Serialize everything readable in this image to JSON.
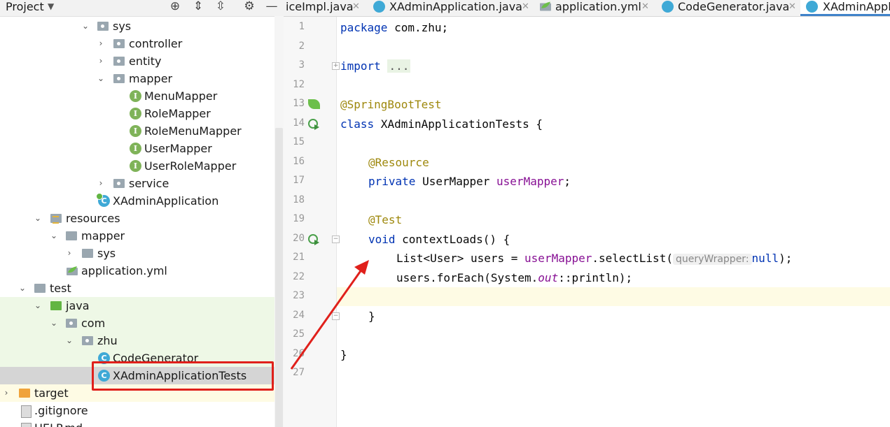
{
  "project_panel": {
    "title": "Project",
    "tree": [
      {
        "label": "sys",
        "type": "package",
        "arrow": "down"
      },
      {
        "label": "controller",
        "type": "package",
        "arrow": "right"
      },
      {
        "label": "entity",
        "type": "package",
        "arrow": "right"
      },
      {
        "label": "mapper",
        "type": "package",
        "arrow": "down"
      },
      {
        "label": "MenuMapper",
        "type": "interface"
      },
      {
        "label": "RoleMapper",
        "type": "interface"
      },
      {
        "label": "RoleMenuMapper",
        "type": "interface"
      },
      {
        "label": "UserMapper",
        "type": "interface"
      },
      {
        "label": "UserRoleMapper",
        "type": "interface"
      },
      {
        "label": "service",
        "type": "package",
        "arrow": "right"
      },
      {
        "label": "XAdminApplication",
        "type": "class"
      },
      {
        "label": "resources",
        "type": "resources-folder",
        "arrow": "down"
      },
      {
        "label": "mapper",
        "type": "folder",
        "arrow": "down"
      },
      {
        "label": "sys",
        "type": "folder",
        "arrow": "right"
      },
      {
        "label": "application.yml",
        "type": "yml"
      },
      {
        "label": "test",
        "type": "folder",
        "arrow": "down"
      },
      {
        "label": "java",
        "type": "test-folder",
        "arrow": "down"
      },
      {
        "label": "com",
        "type": "package",
        "arrow": "down"
      },
      {
        "label": "zhu",
        "type": "package",
        "arrow": "down"
      },
      {
        "label": "CodeGenerator",
        "type": "class"
      },
      {
        "label": "XAdminApplicationTests",
        "type": "class",
        "selected": true
      },
      {
        "label": "target",
        "type": "excluded-folder",
        "arrow": "right"
      },
      {
        "label": ".gitignore",
        "type": "file"
      },
      {
        "label": "HELP.md",
        "type": "file"
      }
    ]
  },
  "tabs": [
    {
      "label": "iceImpl.java",
      "icon": "none"
    },
    {
      "label": "XAdminApplication.java",
      "icon": "class-icon"
    },
    {
      "label": "application.yml",
      "icon": "spring-yml-icon"
    },
    {
      "label": "CodeGenerator.java",
      "icon": "class-icon"
    },
    {
      "label": "XAdminAppli",
      "icon": "class-icon",
      "active": true
    }
  ],
  "editor": {
    "line_numbers": [
      "1",
      "2",
      "3",
      "12",
      "13",
      "14",
      "15",
      "16",
      "17",
      "18",
      "19",
      "20",
      "21",
      "22",
      "23",
      "24",
      "25",
      "26",
      "27"
    ],
    "code": {
      "package_kw": "package",
      "package_name": " com.zhu;",
      "import_kw": "import",
      "import_ellipsis": "...",
      "annotation_springboot": "@SpringBootTest",
      "class_kw": "class",
      "class_name": " XAdminApplicationTests {",
      "annotation_resource": "@Resource",
      "private_kw": "private",
      "field_type": " UserMapper ",
      "field_name": "userMapper",
      "semicolon": ";",
      "annotation_test": "@Test",
      "void_kw": "void",
      "method_sig": " contextLoads() {",
      "line21_prefix": "List<User> users = ",
      "line21_field": "userMapper",
      "line21_call": ".selectList(",
      "line21_hint": "queryWrapper:",
      "line21_null": "null",
      "line21_end": ");",
      "line22_prefix": "users.forEach(System.",
      "line22_out": "out",
      "line22_end": "::println);",
      "method_close": "}",
      "class_close": "}"
    }
  },
  "colors": {
    "annotation_arrow": "#e0201b",
    "selected_highlight": "#e0201b",
    "keyword": "#0033b3",
    "annotation": "#9e880d",
    "field": "#871094"
  }
}
